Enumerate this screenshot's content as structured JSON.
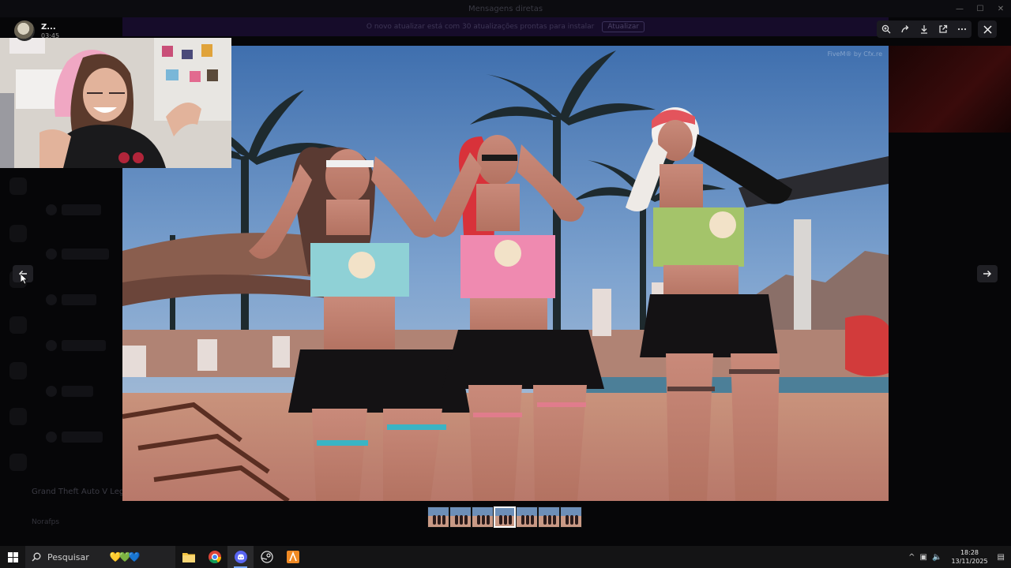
{
  "window": {
    "title": "Mensagens diretas"
  },
  "banner": {
    "text": "O novo atualizar está com 30 atualizações prontas para instalar",
    "button": "Atualizar"
  },
  "viewer": {
    "user_name": "Z...",
    "timestamp": "03:45",
    "watermark": "FiveM® by Cfx.re",
    "tools": [
      "zoom-icon",
      "forward-icon",
      "download-icon",
      "open-external-icon",
      "more-icon"
    ],
    "thumbnails_count": 7,
    "active_thumbnail": 3
  },
  "background": {
    "game_title": "Grand Theft Auto V Legacy",
    "game_subtitle": "",
    "user": "Norafps",
    "user_status": ""
  },
  "taskbar": {
    "search_placeholder": "Pesquisar",
    "time": "18:28",
    "date": "13/11/2025",
    "apps": [
      "file-explorer-icon",
      "chrome-icon",
      "discord-icon",
      "steam-icon",
      "app-icon"
    ]
  },
  "colors": {
    "accent": "#5865f2",
    "overlay": "#060608",
    "taskbar": "#141415"
  }
}
